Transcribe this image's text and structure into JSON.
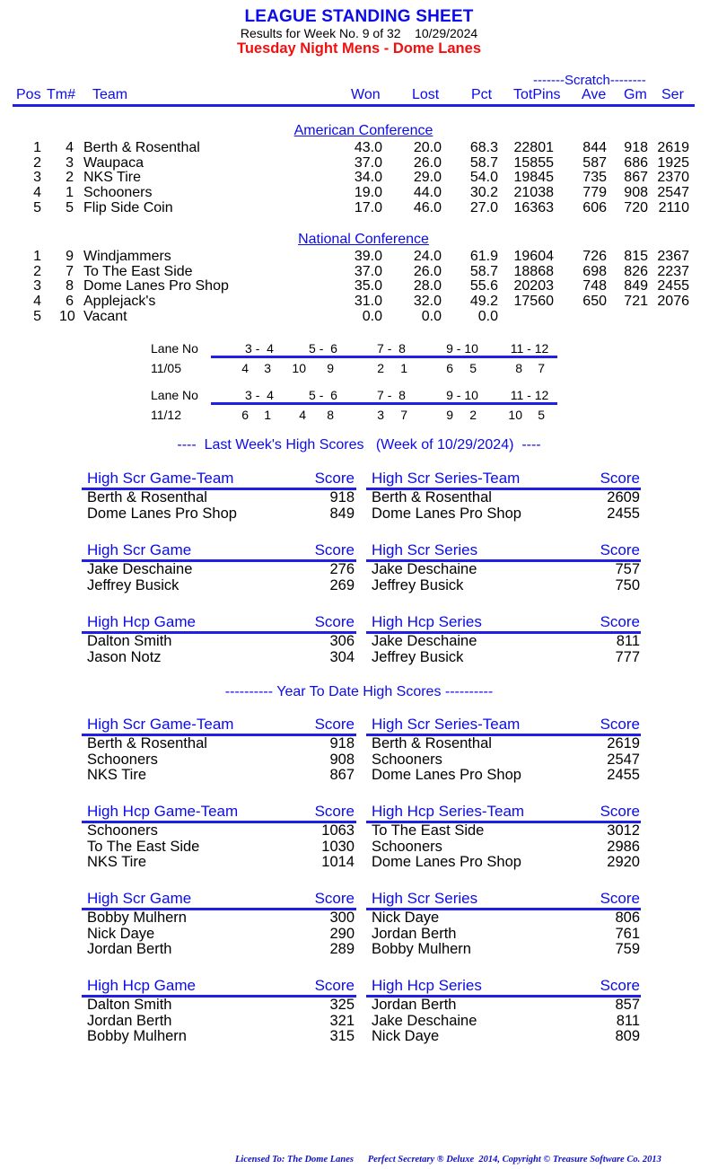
{
  "header": {
    "title": "LEAGUE STANDING SHEET",
    "subtitle": "Results for Week No. 9 of 32    10/29/2024",
    "league": "Tuesday Night Mens - Dome Lanes",
    "scratch_label": "-------Scratch--------"
  },
  "columns": {
    "pos": "Pos",
    "tm": "Tm#",
    "team": "Team",
    "won": "Won",
    "lost": "Lost",
    "pct": "Pct",
    "totpins": "TotPins",
    "ave": "Ave",
    "gm": "Gm",
    "ser": "Ser"
  },
  "conferences": [
    {
      "name": "American Conference",
      "rows": [
        {
          "pos": "1",
          "tm": "4",
          "team": "Berth & Rosenthal",
          "won": "43.0",
          "lost": "20.0",
          "pct": "68.3",
          "totpins": "22801",
          "ave": "844",
          "gm": "918",
          "ser": "2619"
        },
        {
          "pos": "2",
          "tm": "3",
          "team": "Waupaca",
          "won": "37.0",
          "lost": "26.0",
          "pct": "58.7",
          "totpins": "15855",
          "ave": "587",
          "gm": "686",
          "ser": "1925"
        },
        {
          "pos": "3",
          "tm": "2",
          "team": "NKS Tire",
          "won": "34.0",
          "lost": "29.0",
          "pct": "54.0",
          "totpins": "19845",
          "ave": "735",
          "gm": "867",
          "ser": "2370"
        },
        {
          "pos": "4",
          "tm": "1",
          "team": "Schooners",
          "won": "19.0",
          "lost": "44.0",
          "pct": "30.2",
          "totpins": "21038",
          "ave": "779",
          "gm": "908",
          "ser": "2547"
        },
        {
          "pos": "5",
          "tm": "5",
          "team": "Flip Side Coin",
          "won": "17.0",
          "lost": "46.0",
          "pct": "27.0",
          "totpins": "16363",
          "ave": "606",
          "gm": "720",
          "ser": "2110"
        }
      ]
    },
    {
      "name": "National Conference",
      "rows": [
        {
          "pos": "1",
          "tm": "9",
          "team": "Windjammers",
          "won": "39.0",
          "lost": "24.0",
          "pct": "61.9",
          "totpins": "19604",
          "ave": "726",
          "gm": "815",
          "ser": "2367"
        },
        {
          "pos": "2",
          "tm": "7",
          "team": "To The East Side",
          "won": "37.0",
          "lost": "26.0",
          "pct": "58.7",
          "totpins": "18868",
          "ave": "698",
          "gm": "826",
          "ser": "2237"
        },
        {
          "pos": "3",
          "tm": "8",
          "team": "Dome Lanes Pro Shop",
          "won": "35.0",
          "lost": "28.0",
          "pct": "55.6",
          "totpins": "20203",
          "ave": "748",
          "gm": "849",
          "ser": "2455"
        },
        {
          "pos": "4",
          "tm": "6",
          "team": "Applejack's",
          "won": "31.0",
          "lost": "32.0",
          "pct": "49.2",
          "totpins": "17560",
          "ave": "650",
          "gm": "721",
          "ser": "2076"
        },
        {
          "pos": "5",
          "tm": "10",
          "team": "Vacant",
          "won": "0.0",
          "lost": "0.0",
          "pct": "0.0",
          "totpins": "",
          "ave": "",
          "gm": "",
          "ser": ""
        }
      ]
    }
  ],
  "lane_assignments": [
    {
      "label": "Lane No",
      "lanes": [
        "3 -  4",
        "5 -  6",
        "7 -  8",
        "9 - 10",
        "11 - 12"
      ],
      "date": "11/05",
      "pairs": [
        [
          "4",
          "3"
        ],
        [
          "10",
          "9"
        ],
        [
          "2",
          "1"
        ],
        [
          "6",
          "5"
        ],
        [
          "8",
          "7"
        ]
      ]
    },
    {
      "label": "Lane No",
      "lanes": [
        "3 -  4",
        "5 -  6",
        "7 -  8",
        "9 - 10",
        "11 - 12"
      ],
      "date": "11/12",
      "pairs": [
        [
          "6",
          "1"
        ],
        [
          "4",
          "8"
        ],
        [
          "3",
          "7"
        ],
        [
          "9",
          "2"
        ],
        [
          "10",
          "5"
        ]
      ]
    }
  ],
  "last_week": {
    "heading": "----  Last Week's High Scores   (Week of 10/29/2024)  ----",
    "blocks": [
      {
        "title": "High Scr Game-Team",
        "score_label": "Score",
        "rows": [
          {
            "name": "Berth & Rosenthal",
            "score": "918"
          },
          {
            "name": "Dome Lanes Pro Shop",
            "score": "849"
          }
        ]
      },
      {
        "title": "High Scr Series-Team",
        "score_label": "Score",
        "rows": [
          {
            "name": "Berth & Rosenthal",
            "score": "2609"
          },
          {
            "name": "Dome Lanes Pro Shop",
            "score": "2455"
          }
        ]
      },
      {
        "title": "High Scr Game",
        "score_label": "Score",
        "rows": [
          {
            "name": "Jake Deschaine",
            "score": "276"
          },
          {
            "name": "Jeffrey Busick",
            "score": "269"
          }
        ]
      },
      {
        "title": "High Scr Series",
        "score_label": "Score",
        "rows": [
          {
            "name": "Jake Deschaine",
            "score": "757"
          },
          {
            "name": "Jeffrey Busick",
            "score": "750"
          }
        ]
      },
      {
        "title": "High Hcp Game",
        "score_label": "Score",
        "rows": [
          {
            "name": "Dalton Smith",
            "score": "306"
          },
          {
            "name": "Jason Notz",
            "score": "304"
          }
        ]
      },
      {
        "title": "High Hcp Series",
        "score_label": "Score",
        "rows": [
          {
            "name": "Jake Deschaine",
            "score": "811"
          },
          {
            "name": "Jeffrey Busick",
            "score": "777"
          }
        ]
      }
    ]
  },
  "year_to_date": {
    "heading": "---------- Year To Date High Scores ----------",
    "blocks": [
      {
        "title": "High Scr Game-Team",
        "score_label": "Score",
        "rows": [
          {
            "name": "Berth & Rosenthal",
            "score": "918"
          },
          {
            "name": "Schooners",
            "score": "908"
          },
          {
            "name": "NKS Tire",
            "score": "867"
          }
        ]
      },
      {
        "title": "High Scr Series-Team",
        "score_label": "Score",
        "rows": [
          {
            "name": "Berth & Rosenthal",
            "score": "2619"
          },
          {
            "name": "Schooners",
            "score": "2547"
          },
          {
            "name": "Dome Lanes Pro Shop",
            "score": "2455"
          }
        ]
      },
      {
        "title": "High Hcp Game-Team",
        "score_label": "Score",
        "rows": [
          {
            "name": "Schooners",
            "score": "1063"
          },
          {
            "name": "To The East Side",
            "score": "1030"
          },
          {
            "name": "NKS Tire",
            "score": "1014"
          }
        ]
      },
      {
        "title": "High Hcp Series-Team",
        "score_label": "Score",
        "rows": [
          {
            "name": "To The East Side",
            "score": "3012"
          },
          {
            "name": "Schooners",
            "score": "2986"
          },
          {
            "name": "Dome Lanes Pro Shop",
            "score": "2920"
          }
        ]
      },
      {
        "title": "High Scr Game",
        "score_label": "Score",
        "rows": [
          {
            "name": "Bobby Mulhern",
            "score": "300"
          },
          {
            "name": "Nick Daye",
            "score": "290"
          },
          {
            "name": "Jordan Berth",
            "score": "289"
          }
        ]
      },
      {
        "title": "High Scr Series",
        "score_label": "Score",
        "rows": [
          {
            "name": "Nick Daye",
            "score": "806"
          },
          {
            "name": "Jordan Berth",
            "score": "761"
          },
          {
            "name": "Bobby Mulhern",
            "score": "759"
          }
        ]
      },
      {
        "title": "High Hcp Game",
        "score_label": "Score",
        "rows": [
          {
            "name": "Dalton Smith",
            "score": "325"
          },
          {
            "name": "Jordan Berth",
            "score": "321"
          },
          {
            "name": "Bobby Mulhern",
            "score": "315"
          }
        ]
      },
      {
        "title": "High Hcp Series",
        "score_label": "Score",
        "rows": [
          {
            "name": "Jordan Berth",
            "score": "857"
          },
          {
            "name": "Jake Deschaine",
            "score": "811"
          },
          {
            "name": "Nick Daye",
            "score": "809"
          }
        ]
      }
    ]
  },
  "footer": "Licensed To: The Dome Lanes      Perfect Secretary ® Deluxe  2014, Copyright © Treasure Software Co. 2013"
}
